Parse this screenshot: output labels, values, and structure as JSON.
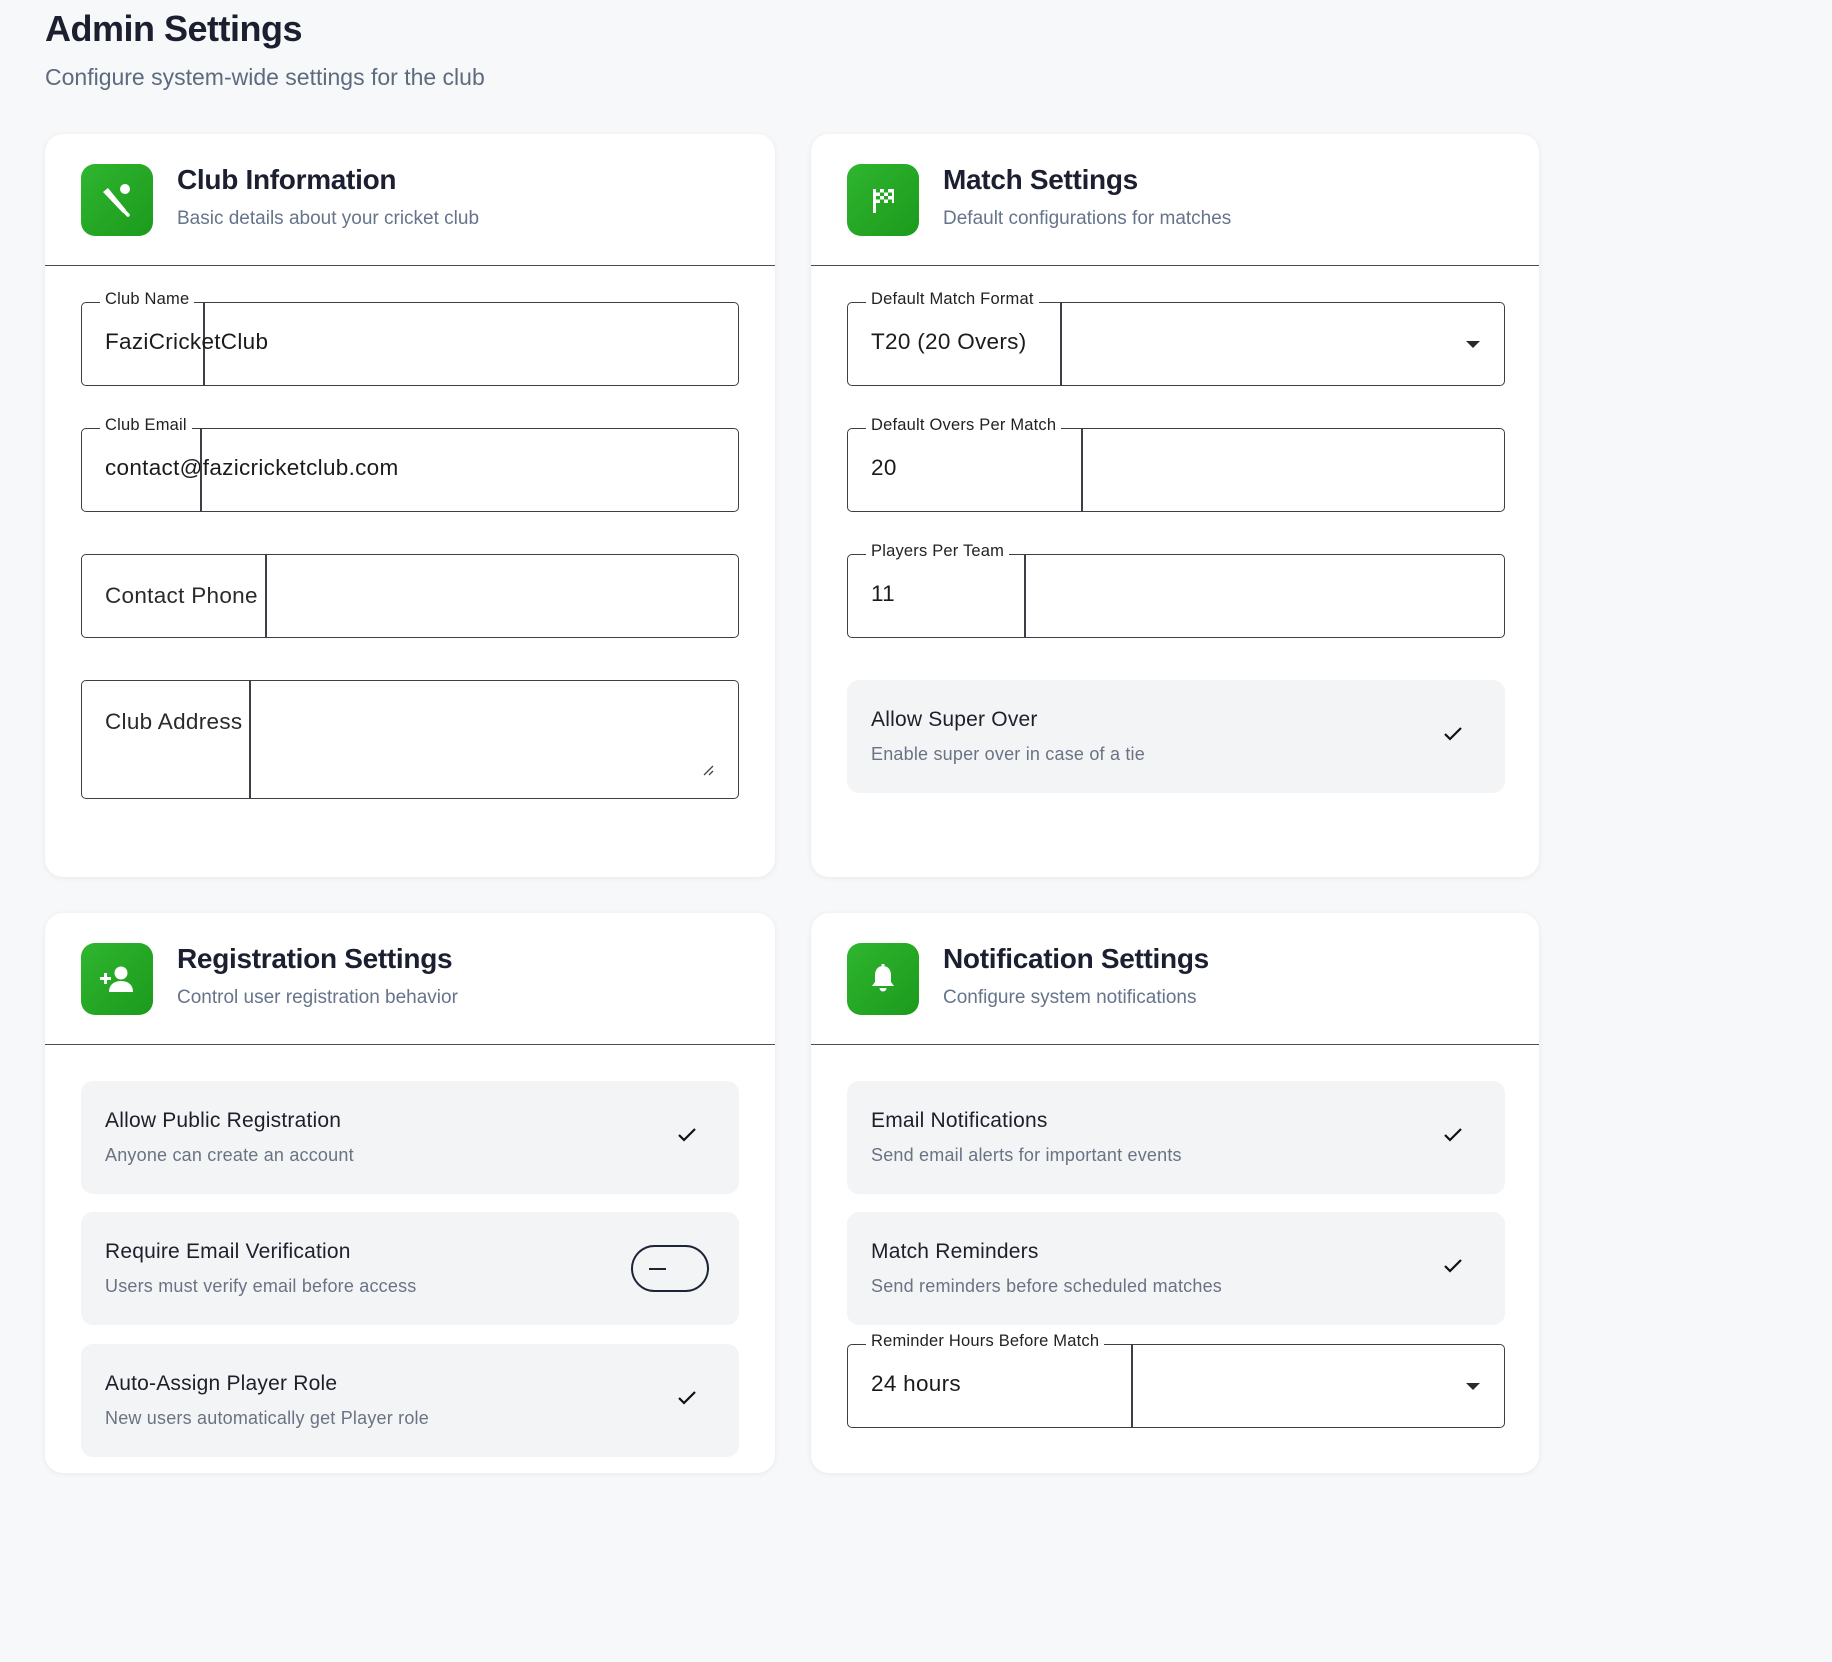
{
  "header": {
    "title": "Admin Settings",
    "subtitle": "Configure system-wide settings for the club"
  },
  "club_info": {
    "title": "Club Information",
    "description": "Basic details about your cricket club",
    "icon": "cricket-icon",
    "fields": {
      "name": {
        "label": "Club Name",
        "value": "FaziCricketClub"
      },
      "email": {
        "label": "Club Email",
        "value": "contact@fazicricketclub.com"
      },
      "phone": {
        "placeholder": "Contact Phone"
      },
      "address": {
        "placeholder": "Club Address"
      }
    }
  },
  "match": {
    "title": "Match Settings",
    "description": "Default configurations for matches",
    "icon": "checkered-flag-icon",
    "format": {
      "label": "Default Match Format",
      "value": "T20 (20 Overs)"
    },
    "overs": {
      "label": "Default Overs Per Match",
      "value": "20"
    },
    "players": {
      "label": "Players Per Team",
      "value": "11"
    },
    "super_over": {
      "label": "Allow Super Over",
      "desc": "Enable super over in case of a tie",
      "checked": true
    }
  },
  "registration": {
    "title": "Registration Settings",
    "description": "Control user registration behavior",
    "icon": "person-add-icon",
    "public": {
      "label": "Allow Public Registration",
      "desc": "Anyone can create an account",
      "checked": true
    },
    "verify": {
      "label": "Require Email Verification",
      "desc": "Users must verify email before access",
      "checked": false
    },
    "auto_role": {
      "label": "Auto-Assign Player Role",
      "desc": "New users automatically get Player role",
      "checked": true
    }
  },
  "notifications": {
    "title": "Notification Settings",
    "description": "Configure system notifications",
    "icon": "bell-icon",
    "email": {
      "label": "Email Notifications",
      "desc": "Send email alerts for important events",
      "checked": true
    },
    "reminders": {
      "label": "Match Reminders",
      "desc": "Send reminders before scheduled matches",
      "checked": true
    },
    "reminder_hours": {
      "label": "Reminder Hours Before Match",
      "value": "24 hours"
    }
  },
  "colors": {
    "accent": "#22a822",
    "border": "#3d3f47",
    "muted": "#66748a"
  }
}
